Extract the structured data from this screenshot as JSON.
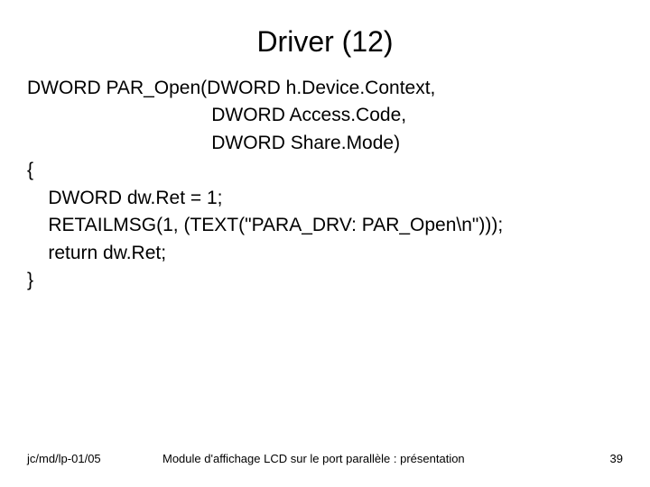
{
  "title": "Driver (12)",
  "code_lines": [
    "DWORD PAR_Open(DWORD h.Device.Context,",
    "                                   DWORD Access.Code,",
    "                                   DWORD Share.Mode)",
    "{",
    "    DWORD dw.Ret = 1;",
    "    RETAILMSG(1, (TEXT(\"PARA_DRV: PAR_Open\\n\")));",
    "",
    "    return dw.Ret;",
    "}"
  ],
  "footer": {
    "left": "jc/md/lp-01/05",
    "center": "Module d'affichage LCD sur le port parallèle : présentation",
    "page": "39"
  }
}
